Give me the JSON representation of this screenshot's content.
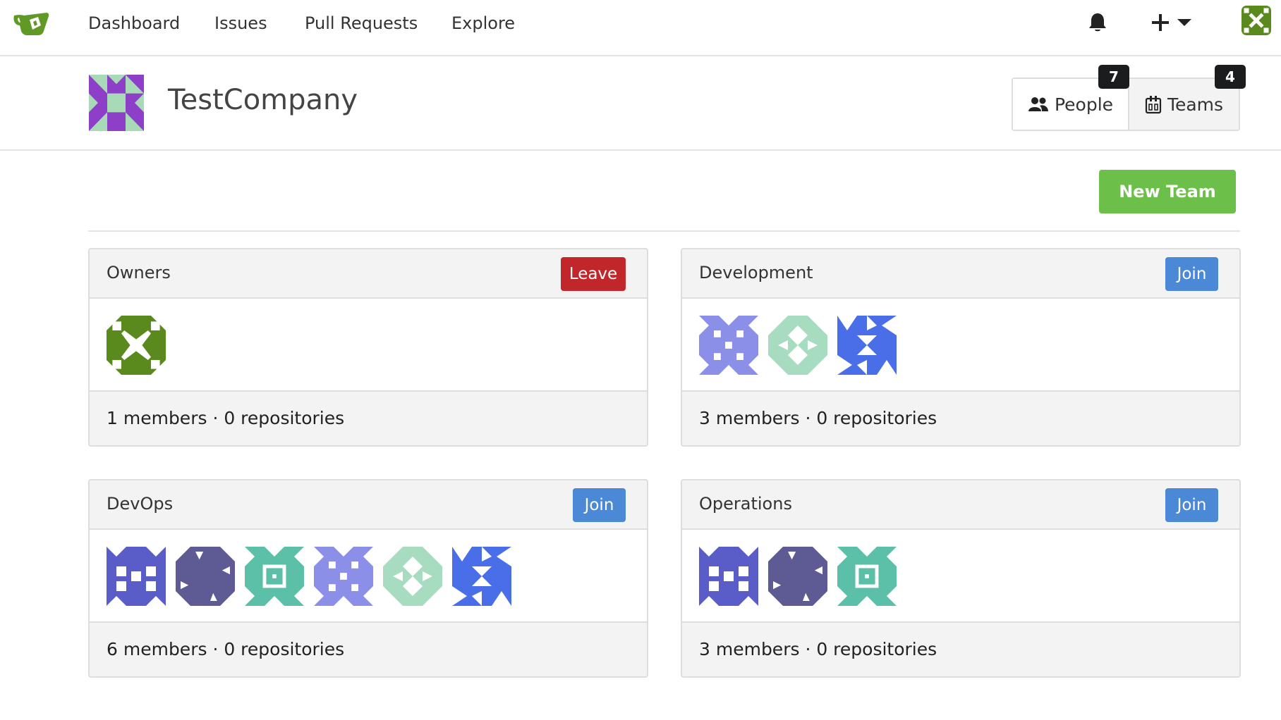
{
  "nav": {
    "links": [
      "Dashboard",
      "Issues",
      "Pull Requests",
      "Explore"
    ],
    "icons": [
      "bell-icon",
      "plus-icon",
      "caret-down-icon"
    ]
  },
  "org": {
    "name": "TestCompany"
  },
  "tabs": {
    "people": {
      "label": "People",
      "count": "7"
    },
    "teams": {
      "label": "Teams",
      "count": "4"
    }
  },
  "toolbar": {
    "new_team_label": "New Team"
  },
  "teams": [
    {
      "name": "Owners",
      "action": "Leave",
      "footer": "1 members · 0 repositories"
    },
    {
      "name": "Development",
      "action": "Join",
      "footer": "3 members · 0 repositories"
    },
    {
      "name": "DevOps",
      "action": "Join",
      "footer": "6 members · 0 repositories"
    },
    {
      "name": "Operations",
      "action": "Join",
      "footer": "3 members · 0 repositories"
    }
  ],
  "colors": {
    "brand_green": "#609926",
    "new_team_green": "#6cc04a",
    "leave_red": "#c0262a",
    "join_blue": "#4b88d6",
    "org_avatar_purple": "#8e3fc7",
    "org_avatar_mint": "#a8dab8",
    "identicon_periwinkle": "#8b8fe8",
    "identicon_mint": "#a8dcc0",
    "identicon_blue": "#4a6ee8",
    "identicon_indigo": "#5a5dc8",
    "identicon_slate": "#5e5a94",
    "identicon_teal": "#5cc0a8",
    "identicon_olive": "#5a8a1e"
  }
}
